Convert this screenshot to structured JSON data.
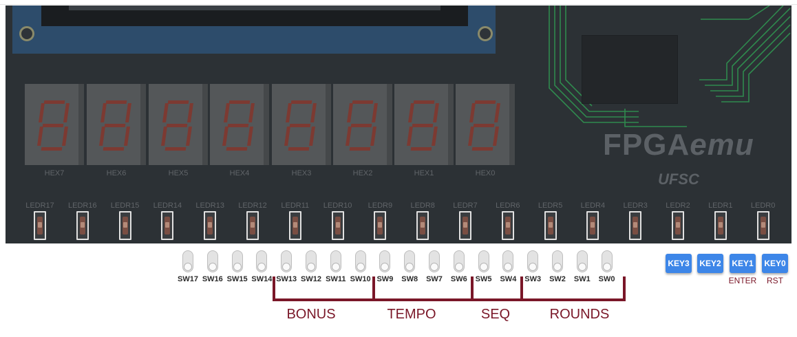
{
  "board": {
    "brand": "FPGA",
    "brand_suffix": "emu",
    "brand_sub": "UFSC"
  },
  "hex_displays": [
    "HEX7",
    "HEX6",
    "HEX5",
    "HEX4",
    "HEX3",
    "HEX2",
    "HEX1",
    "HEX0"
  ],
  "leds": [
    "LEDR17",
    "LEDR16",
    "LEDR15",
    "LEDR14",
    "LEDR13",
    "LEDR12",
    "LEDR11",
    "LEDR10",
    "LEDR9",
    "LEDR8",
    "LEDR7",
    "LEDR6",
    "LEDR5",
    "LEDR4",
    "LEDR3",
    "LEDR2",
    "LEDR1",
    "LEDR0"
  ],
  "switches": [
    "SW17",
    "SW16",
    "SW15",
    "SW14",
    "SW13",
    "SW12",
    "SW11",
    "SW10",
    "SW9",
    "SW8",
    "SW7",
    "SW6",
    "SW5",
    "SW4",
    "SW3",
    "SW2",
    "SW1",
    "SW0"
  ],
  "keys": [
    {
      "label": "KEY3",
      "sub": ""
    },
    {
      "label": "KEY2",
      "sub": ""
    },
    {
      "label": "KEY1",
      "sub": "ENTER"
    },
    {
      "label": "KEY0",
      "sub": "RST"
    }
  ],
  "groups": [
    "BONUS",
    "TEMPO",
    "SEQ",
    "ROUNDS"
  ],
  "colors": {
    "board": "#2c3135",
    "key": "#3d86e8",
    "annotation": "#7a1728",
    "trace": "#2f8a4e"
  }
}
